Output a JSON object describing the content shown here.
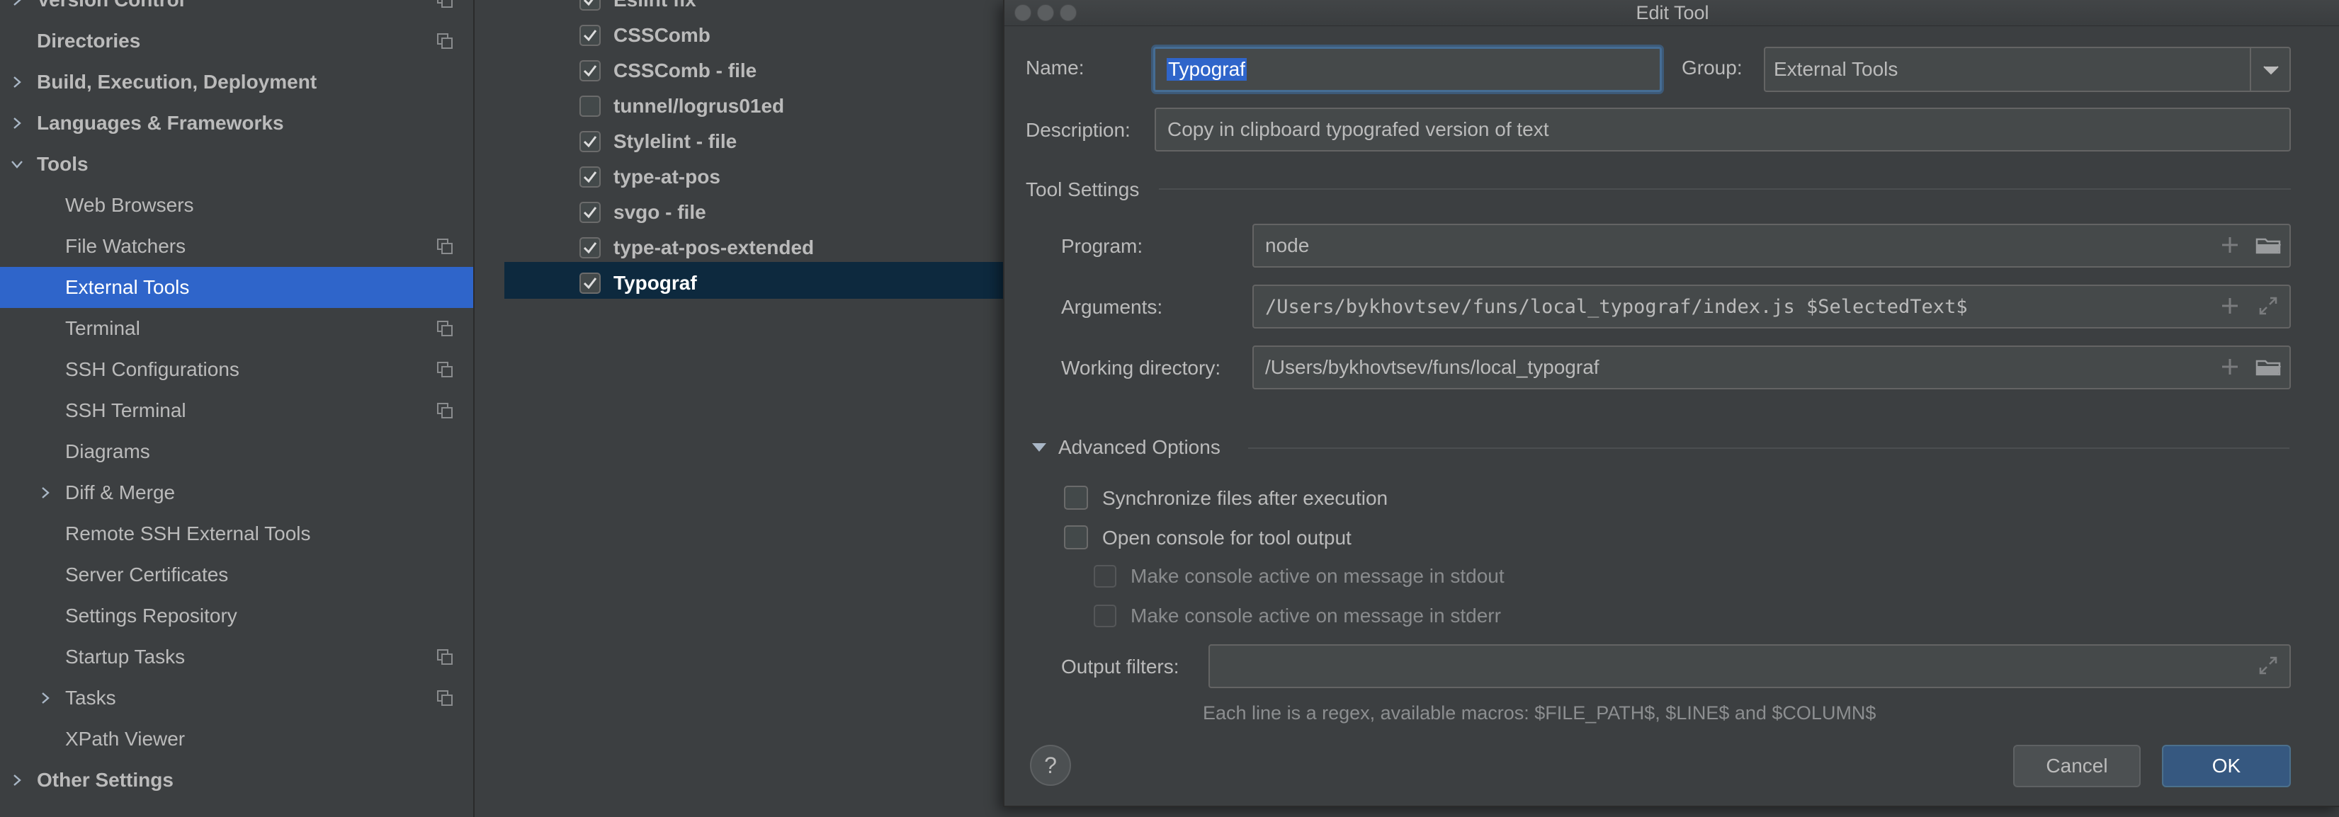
{
  "sidebar": {
    "items": [
      {
        "label": "Version Control",
        "level": 0,
        "bold": true,
        "chevron": "right",
        "project_icon": true
      },
      {
        "label": "Directories",
        "level": 0,
        "bold": true,
        "chevron": "",
        "project_icon": true
      },
      {
        "label": "Build, Execution, Deployment",
        "level": 0,
        "bold": true,
        "chevron": "right",
        "project_icon": false
      },
      {
        "label": "Languages & Frameworks",
        "level": 0,
        "bold": true,
        "chevron": "right",
        "project_icon": false
      },
      {
        "label": "Tools",
        "level": 0,
        "bold": true,
        "chevron": "down",
        "project_icon": false
      },
      {
        "label": "Web Browsers",
        "level": 1,
        "bold": false,
        "chevron": "",
        "project_icon": false
      },
      {
        "label": "File Watchers",
        "level": 1,
        "bold": false,
        "chevron": "",
        "project_icon": true
      },
      {
        "label": "External Tools",
        "level": 1,
        "bold": false,
        "chevron": "",
        "project_icon": false,
        "selected": true
      },
      {
        "label": "Terminal",
        "level": 1,
        "bold": false,
        "chevron": "",
        "project_icon": true
      },
      {
        "label": "SSH Configurations",
        "level": 1,
        "bold": false,
        "chevron": "",
        "project_icon": true
      },
      {
        "label": "SSH Terminal",
        "level": 1,
        "bold": false,
        "chevron": "",
        "project_icon": true
      },
      {
        "label": "Diagrams",
        "level": 1,
        "bold": false,
        "chevron": "",
        "project_icon": false
      },
      {
        "label": "Diff & Merge",
        "level": 1,
        "bold": false,
        "chevron": "right",
        "project_icon": false
      },
      {
        "label": "Remote SSH External Tools",
        "level": 1,
        "bold": false,
        "chevron": "",
        "project_icon": false
      },
      {
        "label": "Server Certificates",
        "level": 1,
        "bold": false,
        "chevron": "",
        "project_icon": false
      },
      {
        "label": "Settings Repository",
        "level": 1,
        "bold": false,
        "chevron": "",
        "project_icon": false
      },
      {
        "label": "Startup Tasks",
        "level": 1,
        "bold": false,
        "chevron": "",
        "project_icon": true
      },
      {
        "label": "Tasks",
        "level": 1,
        "bold": false,
        "chevron": "right",
        "project_icon": true
      },
      {
        "label": "XPath Viewer",
        "level": 1,
        "bold": false,
        "chevron": "",
        "project_icon": false
      },
      {
        "label": "Other Settings",
        "level": 0,
        "bold": true,
        "chevron": "right",
        "project_icon": false
      }
    ]
  },
  "tools": [
    {
      "label": "Eslint fix",
      "checked": true
    },
    {
      "label": "CSSComb",
      "checked": true
    },
    {
      "label": "CSSComb - file",
      "checked": true
    },
    {
      "label": "tunnel/logrus01ed",
      "checked": false
    },
    {
      "label": "Stylelint - file",
      "checked": true
    },
    {
      "label": "type-at-pos",
      "checked": true
    },
    {
      "label": "svgo - file",
      "checked": true
    },
    {
      "label": "type-at-pos-extended",
      "checked": true
    },
    {
      "label": "Typograf",
      "checked": true,
      "selected": true
    }
  ],
  "dialog": {
    "title": "Edit Tool",
    "name_label": "Name:",
    "name_value": "Typograf",
    "group_label": "Group:",
    "group_value": "External Tools",
    "description_label": "Description:",
    "description_value": "Copy in clipboard typografed version of text",
    "tool_settings_title": "Tool Settings",
    "program_label": "Program:",
    "program_value": "node",
    "arguments_label": "Arguments:",
    "arguments_value": "/Users/bykhovtsev/funs/local_typograf/index.js $SelectedText$",
    "working_dir_label": "Working directory:",
    "working_dir_value": "/Users/bykhovtsev/funs/local_typograf",
    "advanced_title": "Advanced Options",
    "sync_label": "Synchronize files after execution",
    "open_console_label": "Open console for tool output",
    "console_stdout_label": "Make console active on message in stdout",
    "console_stderr_label": "Make console active on message in stderr",
    "output_filters_label": "Output filters:",
    "output_filters_value": "",
    "hint": "Each line is a regex, available macros: $FILE_PATH$, $LINE$ and $COLUMN$",
    "help_label": "?",
    "cancel_label": "Cancel",
    "ok_label": "OK"
  },
  "colors": {
    "background": "#3c3f41",
    "selection": "#2f65ca",
    "list_selection": "#0d293e",
    "ok_button": "#365880"
  }
}
